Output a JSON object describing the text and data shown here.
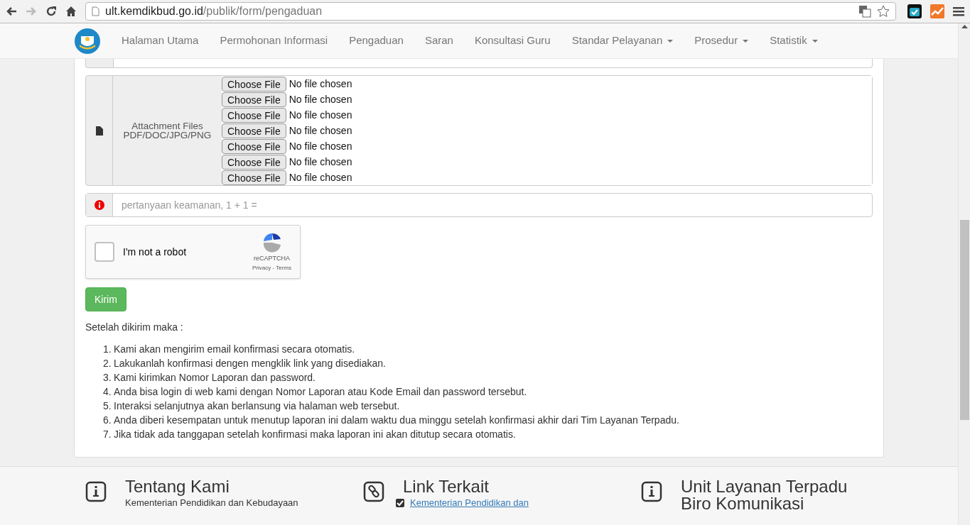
{
  "browser": {
    "url_host": "ult.kemdikbud.go.id",
    "url_path": "/publik/form/pengaduan"
  },
  "navbar": {
    "items": [
      {
        "label": "Halaman Utama",
        "dropdown": false
      },
      {
        "label": "Permohonan Informasi",
        "dropdown": false
      },
      {
        "label": "Pengaduan",
        "dropdown": false
      },
      {
        "label": "Saran",
        "dropdown": false
      },
      {
        "label": "Konsultasi Guru",
        "dropdown": false
      },
      {
        "label": "Standar Pelayanan",
        "dropdown": true
      },
      {
        "label": "Prosedur",
        "dropdown": true
      },
      {
        "label": "Statistik",
        "dropdown": true
      }
    ]
  },
  "attachments": {
    "label_lines": [
      "Attachment Files",
      "PDF/DOC/JPG/PNG"
    ],
    "inputs": [
      {
        "button": "Choose File",
        "status": "No file chosen"
      },
      {
        "button": "Choose File",
        "status": "No file chosen"
      },
      {
        "button": "Choose File",
        "status": "No file chosen"
      },
      {
        "button": "Choose File",
        "status": "No file chosen"
      },
      {
        "button": "Choose File",
        "status": "No file chosen"
      },
      {
        "button": "Choose File",
        "status": "No file chosen"
      },
      {
        "button": "Choose File",
        "status": "No file chosen"
      }
    ]
  },
  "security": {
    "placeholder": "pertanyaan keamanan, 1 + 1 ="
  },
  "captcha": {
    "label": "I'm not a robot",
    "checked": false,
    "brand": "reCAPTCHA",
    "privacy": "Privacy",
    "terms": "Terms",
    "sep": " - "
  },
  "submit": "Kirim",
  "after_title": "Setelah dikirim maka :",
  "steps": [
    {
      "number": "1.",
      "text": "Kami akan mengirim email konfirmasi secara otomatis."
    },
    {
      "number": "2.",
      "text": "Lakukanlah konfirmasi dengen mengklik link yang disediakan."
    },
    {
      "number": "3.",
      "text": "Kami kirimkan Nomor Laporan dan password."
    },
    {
      "number": "4.",
      "text": "Anda bisa login di web kami dengan Nomor Laporan atau Kode Email dan password tersebut."
    },
    {
      "number": "5.",
      "text": "Interaksi selanjutnya akan berlansung via halaman web tersebut."
    },
    {
      "number": "6.",
      "text": "Anda diberi kesempatan untuk menutup laporan ini dalam waktu dua minggu setelah konfirmasi akhir dari Tim Layanan Terpadu."
    },
    {
      "number": "7.",
      "text": "Jika tidak ada tanggapan setelah konfirmasi maka laporan ini akan ditutup secara otomatis."
    }
  ],
  "footer": [
    {
      "kind": "info",
      "title": "Tentang Kami",
      "text": "Kementerian Pendidikan dan Kebudayaan"
    },
    {
      "kind": "link",
      "title": "Link Terkait",
      "text": "Kementerian Pendidikan dan"
    },
    {
      "kind": "info",
      "title": "Unit Layanan Terpadu Biro Komunikasi"
    }
  ]
}
